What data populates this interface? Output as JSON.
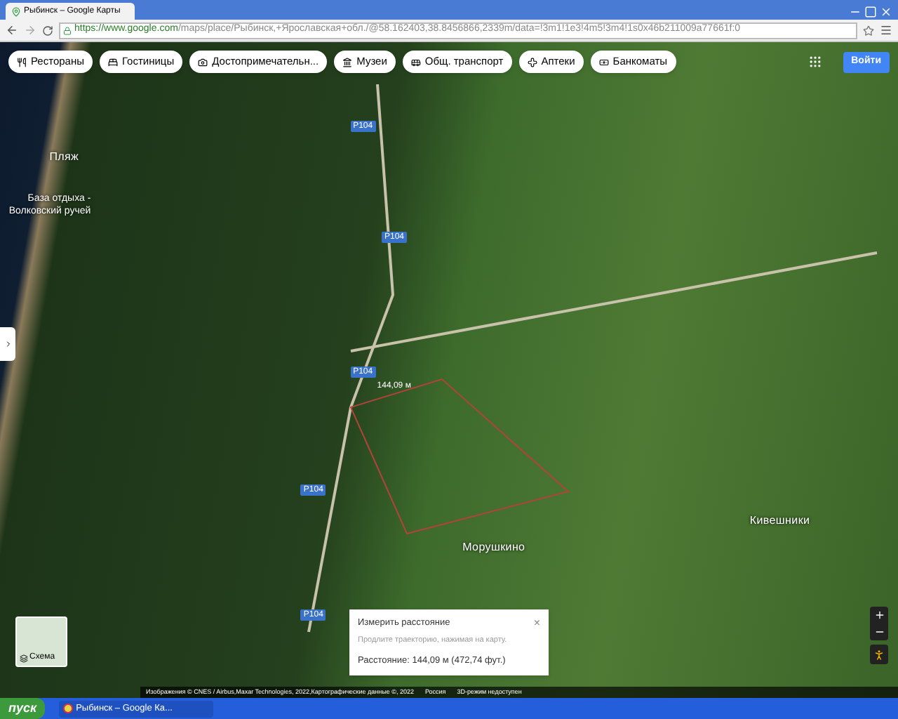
{
  "browser": {
    "tab_title": "Рыбинск – Google Карты",
    "url_host": "https://www.google.com",
    "url_path": "/maps/place/Рыбинск,+Ярославская+обл./@58.162403,38.8456866,2339m/data=!3m1!1e3!4m5!3m4!1s0x46b211009a77661f:0"
  },
  "chips": [
    {
      "kind": "fork",
      "label": "Рестораны"
    },
    {
      "kind": "bed",
      "label": "Гостиницы"
    },
    {
      "kind": "camera",
      "label": "Достопримечательн..."
    },
    {
      "kind": "museum",
      "label": "Музеи"
    },
    {
      "kind": "bus",
      "label": "Общ. транспорт"
    },
    {
      "kind": "pharmacy",
      "label": "Аптеки"
    },
    {
      "kind": "atm",
      "label": "Банкоматы"
    }
  ],
  "sign_in": "Войти",
  "map_labels": [
    {
      "kind": "place",
      "text": "Пляж"
    },
    {
      "kind": "poi",
      "text": "База отдыха -\nВолковский ручей"
    },
    {
      "kind": "road",
      "text": "Р104"
    },
    {
      "kind": "road",
      "text": "Р104"
    },
    {
      "kind": "road",
      "text": "Р104"
    },
    {
      "kind": "road",
      "text": "Р104"
    },
    {
      "kind": "road",
      "text": "Р104"
    },
    {
      "kind": "distance",
      "text": "144,09 м"
    },
    {
      "kind": "place",
      "text": "Морушкино"
    },
    {
      "kind": "place",
      "text": "Кивешники"
    }
  ],
  "measure": {
    "title": "Измерить расстояние",
    "hint": "Продлите траекторию, нажимая на карту.",
    "result": "Расстояние: 144,09 м (472,74 фут.)",
    "close": "×"
  },
  "layer_toggle": "Схема",
  "attribution": [
    "Изображения © CNES / Airbus,Maxar Technologies, 2022,Картографические данные ©, 2022",
    "Россия",
    "3D-режим недоступен"
  ],
  "taskbar": {
    "start": "пуск",
    "window": "Рыбинск – Google Ка..."
  }
}
